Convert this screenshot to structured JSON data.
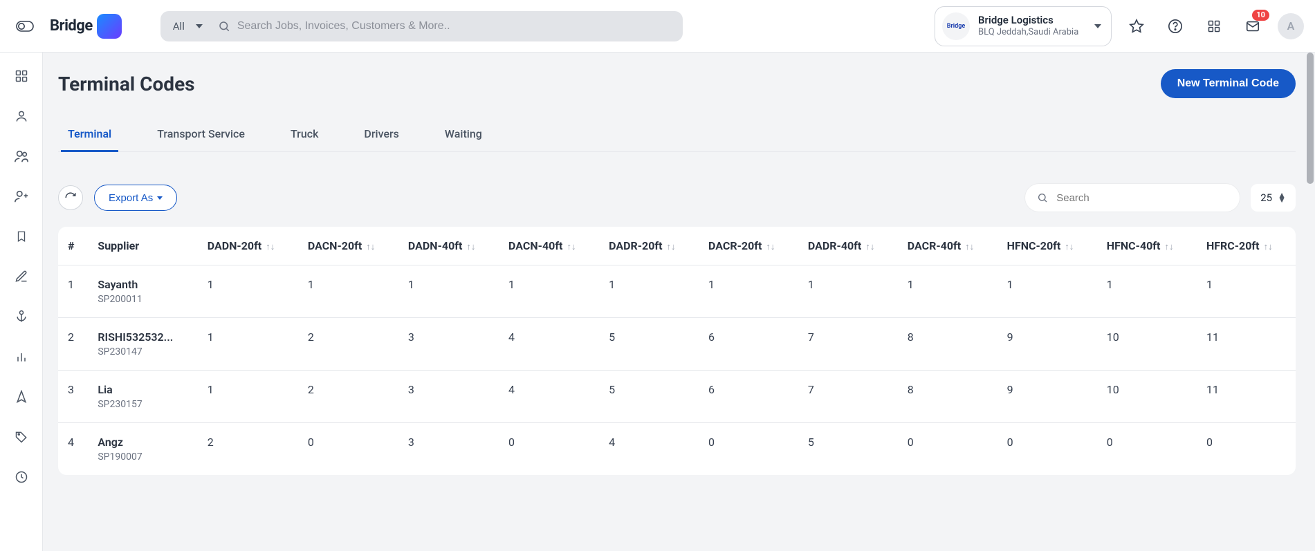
{
  "header": {
    "logo_text": "Bridge",
    "search_category": "All",
    "search_placeholder": "Search Jobs, Invoices, Customers & More..",
    "org_name": "Bridge Logistics",
    "org_location": "BLQ Jeddah,Saudi Arabia",
    "org_logo_text": "Bridge",
    "mail_badge": "10",
    "avatar_letter": "A"
  },
  "page": {
    "title": "Terminal Codes",
    "new_button": "New Terminal Code"
  },
  "tabs": [
    {
      "label": "Terminal",
      "active": true
    },
    {
      "label": "Transport Service",
      "active": false
    },
    {
      "label": "Truck",
      "active": false
    },
    {
      "label": "Drivers",
      "active": false
    },
    {
      "label": "Waiting",
      "active": false
    }
  ],
  "toolbar": {
    "export_label": "Export As",
    "table_search_placeholder": "Search",
    "page_size": "25"
  },
  "table": {
    "columns": [
      {
        "label": "#",
        "sortable": false
      },
      {
        "label": "Supplier",
        "sortable": false
      },
      {
        "label": "DADN-20ft",
        "sortable": true
      },
      {
        "label": "DACN-20ft",
        "sortable": true
      },
      {
        "label": "DADN-40ft",
        "sortable": true
      },
      {
        "label": "DACN-40ft",
        "sortable": true
      },
      {
        "label": "DADR-20ft",
        "sortable": true
      },
      {
        "label": "DACR-20ft",
        "sortable": true
      },
      {
        "label": "DADR-40ft",
        "sortable": true
      },
      {
        "label": "DACR-40ft",
        "sortable": true
      },
      {
        "label": "HFNC-20ft",
        "sortable": true
      },
      {
        "label": "HFNC-40ft",
        "sortable": true
      },
      {
        "label": "HFRC-20ft",
        "sortable": true
      }
    ],
    "rows": [
      {
        "idx": "1",
        "supplier_name": "Sayanth",
        "supplier_code": "SP200011",
        "vals": [
          "1",
          "1",
          "1",
          "1",
          "1",
          "1",
          "1",
          "1",
          "1",
          "1",
          "1"
        ]
      },
      {
        "idx": "2",
        "supplier_name": "RISHI532532...",
        "supplier_code": "SP230147",
        "vals": [
          "1",
          "2",
          "3",
          "4",
          "5",
          "6",
          "7",
          "8",
          "9",
          "10",
          "11"
        ]
      },
      {
        "idx": "3",
        "supplier_name": "Lia",
        "supplier_code": "SP230157",
        "vals": [
          "1",
          "2",
          "3",
          "4",
          "5",
          "6",
          "7",
          "8",
          "9",
          "10",
          "11"
        ]
      },
      {
        "idx": "4",
        "supplier_name": "Angz",
        "supplier_code": "SP190007",
        "vals": [
          "2",
          "0",
          "3",
          "0",
          "4",
          "0",
          "5",
          "0",
          "0",
          "0",
          "0"
        ]
      }
    ]
  }
}
